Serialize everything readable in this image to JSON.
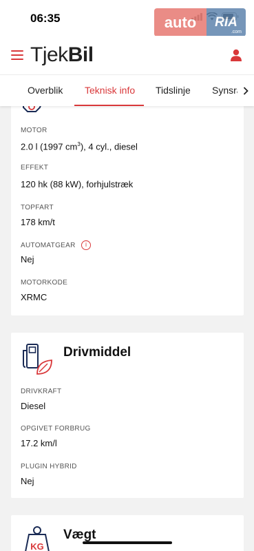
{
  "status_bar": {
    "time": "06:35"
  },
  "watermark": {
    "auto": "auto",
    "ria": "RIA",
    "ria_domain": ".com"
  },
  "header": {
    "logo_light": "Tjek",
    "logo_bold": "Bil"
  },
  "tabs": [
    {
      "label": "Overblik",
      "active": false
    },
    {
      "label": "Teknisk info",
      "active": true
    },
    {
      "label": "Tidslinje",
      "active": false
    },
    {
      "label": "Synsra",
      "active": false
    }
  ],
  "engine_card": {
    "icon": "gear-icon",
    "fields": [
      {
        "label": "MOTOR",
        "value_prefix": "2.0 l (1997 cm",
        "value_sup": "3",
        "value_suffix": "), 4 cyl., diesel"
      },
      {
        "label": "EFFEKT",
        "value": "120 hk (88 kW), forhjulstræk"
      },
      {
        "label": "TOPFART",
        "value": "178 km/t"
      },
      {
        "label": "AUTOMATGEAR",
        "value": "Nej",
        "info": "i"
      },
      {
        "label": "MOTORKODE",
        "value": "XRMC"
      }
    ]
  },
  "fuel_card": {
    "title": "Drivmiddel",
    "icon": "fuel-pump-leaf-icon",
    "fields": [
      {
        "label": "DRIVKRAFT",
        "value": "Diesel"
      },
      {
        "label": "OPGIVET FORBRUG",
        "value": "17.2 km/l"
      },
      {
        "label": "PLUGIN HYBRID",
        "value": "Nej"
      }
    ]
  },
  "weight_card": {
    "title": "Vægt",
    "icon": "kg-weight-icon",
    "icon_text": "KG"
  },
  "colors": {
    "accent": "#d9383a",
    "background": "#f2f2f2",
    "card": "#ffffff"
  }
}
